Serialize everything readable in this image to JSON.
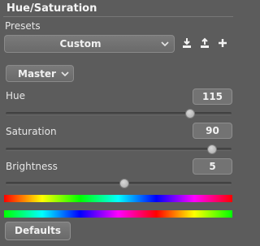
{
  "panel": {
    "title": "Hue/Saturation"
  },
  "presets": {
    "label": "Presets",
    "selected": "Custom",
    "icons": [
      "save-preset-icon",
      "load-preset-icon",
      "add-preset-icon"
    ]
  },
  "mode": {
    "selected": "Master"
  },
  "sliders": [
    {
      "key": "hue",
      "label": "Hue",
      "value": "115",
      "position": 0.815
    },
    {
      "key": "saturation",
      "label": "Saturation",
      "value": "90",
      "position": 0.915
    },
    {
      "key": "brightness",
      "label": "Brightness",
      "value": "5",
      "position": 0.525
    }
  ],
  "spectrum": {
    "input_colors": [
      "#ff0000",
      "#ffff00",
      "#00ff00",
      "#00ffff",
      "#0000ff",
      "#ff00ff",
      "#ff0000"
    ],
    "output_colors": [
      "#00ff00",
      "#00ffff",
      "#0000ff",
      "#ff00ff",
      "#ff0000",
      "#ffff00",
      "#00ff00"
    ]
  },
  "buttons": {
    "defaults_label": "Defaults"
  },
  "colors": {
    "background": "#5c5c5c",
    "control": "#737373",
    "text": "#ececec"
  }
}
